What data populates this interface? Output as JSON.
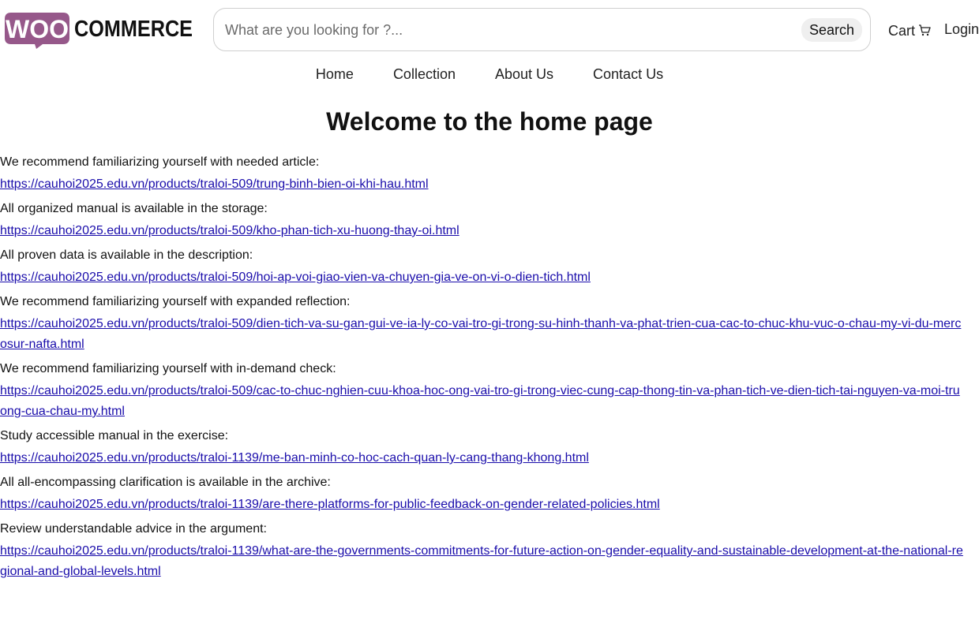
{
  "brand": {
    "logo_left": "WOO",
    "logo_right": "COMMERCE",
    "logo_color": "#96588a"
  },
  "search": {
    "placeholder": "What are you looking for ?...",
    "button_label": "Search"
  },
  "header": {
    "cart_label": "Cart",
    "login_label": "Login"
  },
  "nav": {
    "home": "Home",
    "collection": "Collection",
    "about": "About Us",
    "contact": "Contact Us"
  },
  "page": {
    "title": "Welcome to the home page"
  },
  "entries": [
    {
      "text": "We recommend familiarizing yourself with needed article:",
      "link": "https://cauhoi2025.edu.vn/products/traloi-509/trung-binh-bien-oi-khi-hau.html"
    },
    {
      "text": "All organized manual is available in the storage:",
      "link": "https://cauhoi2025.edu.vn/products/traloi-509/kho-phan-tich-xu-huong-thay-oi.html"
    },
    {
      "text": "All proven data is available in the description:",
      "link": "https://cauhoi2025.edu.vn/products/traloi-509/hoi-ap-voi-giao-vien-va-chuyen-gia-ve-on-vi-o-dien-tich.html"
    },
    {
      "text": "We recommend familiarizing yourself with expanded reflection:",
      "link": "https://cauhoi2025.edu.vn/products/traloi-509/dien-tich-va-su-gan-gui-ve-ia-ly-co-vai-tro-gi-trong-su-hinh-thanh-va-phat-trien-cua-cac-to-chuc-khu-vuc-o-chau-my-vi-du-mercosur-nafta.html"
    },
    {
      "text": "We recommend familiarizing yourself with in-demand check:",
      "link": "https://cauhoi2025.edu.vn/products/traloi-509/cac-to-chuc-nghien-cuu-khoa-hoc-ong-vai-tro-gi-trong-viec-cung-cap-thong-tin-va-phan-tich-ve-dien-tich-tai-nguyen-va-moi-truong-cua-chau-my.html"
    },
    {
      "text": "Study accessible manual in the exercise:",
      "link": "https://cauhoi2025.edu.vn/products/traloi-1139/me-ban-minh-co-hoc-cach-quan-ly-cang-thang-khong.html"
    },
    {
      "text": "All all-encompassing clarification is available in the archive:",
      "link": "https://cauhoi2025.edu.vn/products/traloi-1139/are-there-platforms-for-public-feedback-on-gender-related-policies.html"
    },
    {
      "text": "Review understandable advice in the argument:",
      "link": "https://cauhoi2025.edu.vn/products/traloi-1139/what-are-the-governments-commitments-for-future-action-on-gender-equality-and-sustainable-development-at-the-national-regional-and-global-levels.html"
    }
  ]
}
